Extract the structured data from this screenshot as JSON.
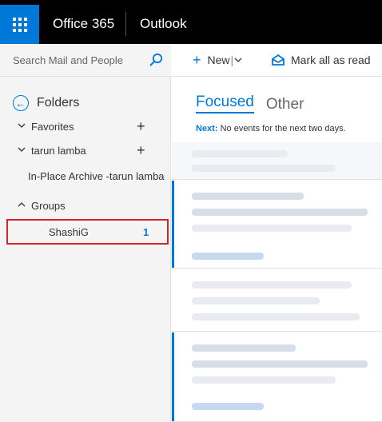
{
  "header": {
    "app_suite": "Office 365",
    "app_name": "Outlook",
    "accent": "#0078d7",
    "bar_color": "#000000"
  },
  "search": {
    "placeholder": "Search Mail and People",
    "icon": "search-icon"
  },
  "folders": {
    "title": "Folders",
    "items": [
      {
        "label": "Favorites",
        "expanded": true,
        "icon": "chevron-down-icon",
        "action": "+"
      },
      {
        "label": "tarun lamba",
        "expanded": true,
        "icon": "chevron-down-icon",
        "action": "+"
      },
      {
        "label": "In-Place Archive -tarun lamba"
      },
      {
        "label": "Groups",
        "expanded": true,
        "icon": "chevron-up-icon"
      }
    ],
    "group_item": {
      "label": "ShashiG",
      "count": "1",
      "highlight_color": "#d9222a"
    }
  },
  "toolbar": {
    "new_label": "New",
    "new_icon": "plus-icon",
    "mark_all_label": "Mark all as read",
    "mark_all_icon": "envelope-open-icon"
  },
  "inbox": {
    "tabs": [
      {
        "label": "Focused",
        "active": true
      },
      {
        "label": "Other",
        "active": false
      }
    ],
    "next_label": "Next:",
    "next_text": "No events for the next two days."
  }
}
